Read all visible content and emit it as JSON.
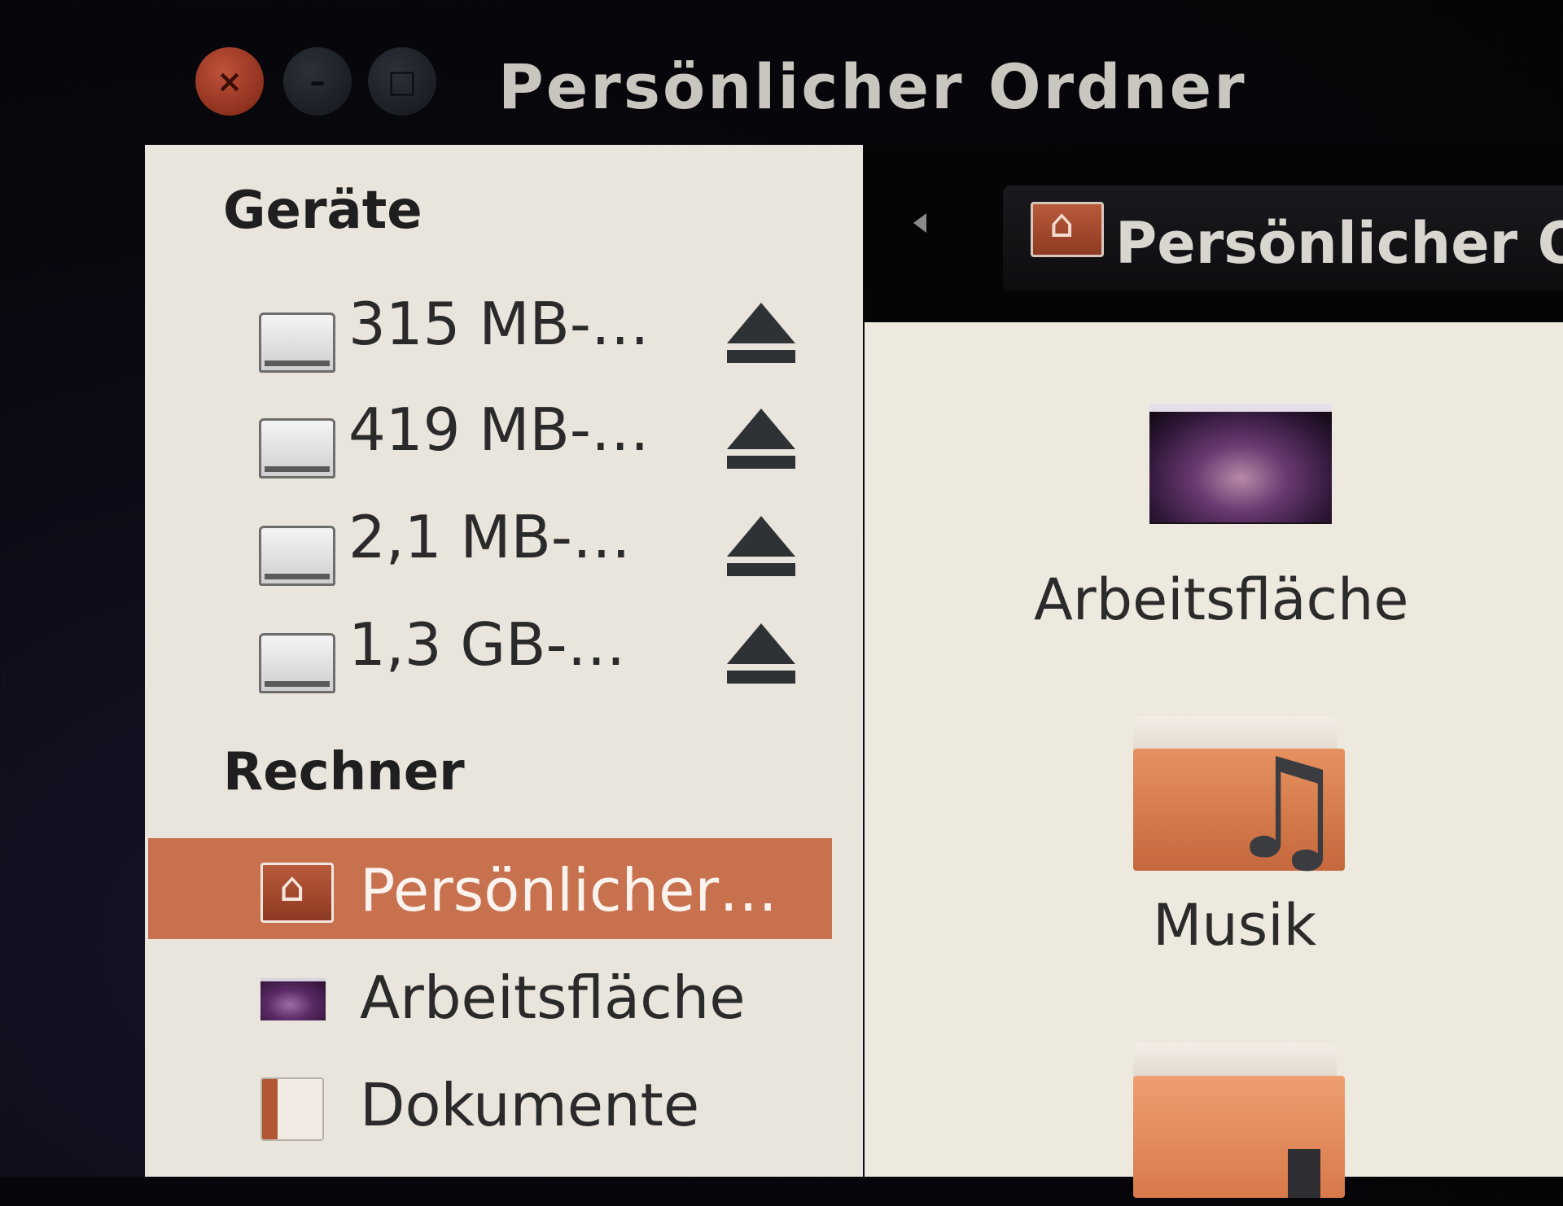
{
  "window": {
    "title": "Persönlicher Ordner",
    "buttons": {
      "close_glyph": "×",
      "minimize_glyph": "–",
      "maximize_glyph": "□"
    }
  },
  "sidebar": {
    "devices_header": "Geräte",
    "devices": [
      {
        "label": "315 MB-…",
        "icon": "drive-icon",
        "eject_icon": "eject-icon"
      },
      {
        "label": "419 MB-…",
        "icon": "drive-icon",
        "eject_icon": "eject-icon"
      },
      {
        "label": "2,1 MB-…",
        "icon": "drive-icon",
        "eject_icon": "eject-icon"
      },
      {
        "label": "1,3 GB-…",
        "icon": "drive-icon",
        "eject_icon": "eject-icon"
      }
    ],
    "computer_header": "Rechner",
    "places": [
      {
        "label": "Persönlicher…",
        "icon": "home-folder-icon",
        "selected": true
      },
      {
        "label": "Arbeitsfläche",
        "icon": "desktop-icon",
        "selected": false
      },
      {
        "label": "Dokumente",
        "icon": "documents-folder-icon",
        "selected": false
      }
    ]
  },
  "toolbar": {
    "back_icon": "back-arrow-icon",
    "path_button_label": "Persönlicher O",
    "path_button_icon": "home-folder-icon"
  },
  "main": {
    "items": [
      {
        "label": "Arbeitsfläche",
        "icon": "desktop-icon"
      },
      {
        "label": "Musik",
        "icon": "music-folder-icon"
      },
      {
        "label": "",
        "icon": "folder-icon"
      }
    ]
  },
  "colors": {
    "selection": "#c8714e",
    "close_button": "#a63c26",
    "sidebar_background": "#e9e5dc",
    "toolbar_background": "#050507"
  }
}
